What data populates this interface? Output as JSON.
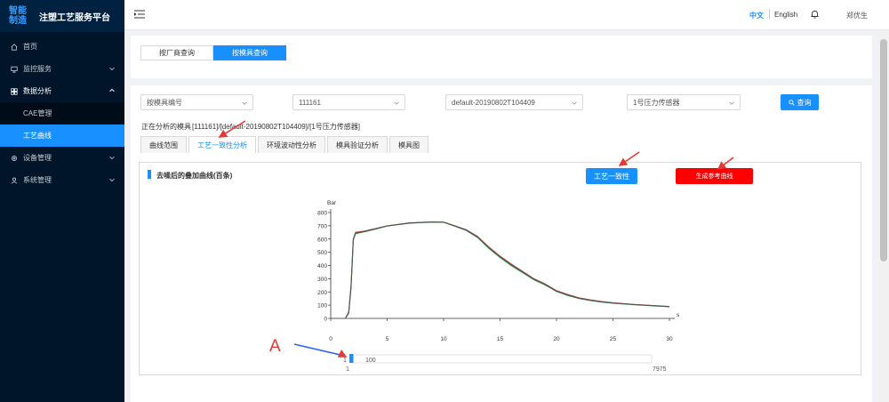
{
  "app": {
    "logo_line1": "智能",
    "logo_line2": "制造",
    "title": "注塑工艺服务平台"
  },
  "sidebar": {
    "items": [
      {
        "label": "首页"
      },
      {
        "label": "监控服务"
      },
      {
        "label": "数据分析"
      },
      {
        "label": "设备管理"
      },
      {
        "label": "系统管理"
      }
    ],
    "submenu": [
      {
        "label": "CAE管理"
      },
      {
        "label": "工艺曲线"
      }
    ]
  },
  "header": {
    "lang_zh": "中文",
    "lang_en": "English",
    "user": "郑优生"
  },
  "query_mode": {
    "by_vendor": "按厂商查询",
    "by_mold": "按模具查询"
  },
  "filters": {
    "mold_type": "按模具编号",
    "mold_no": "111161",
    "config": "default-20190802T104409",
    "sensor": "1号压力传感器",
    "query_label": "查询"
  },
  "analysis": {
    "label": "正在分析的模具",
    "value": "[111161]/[default-20190802T104409]/[1号压力传感器]"
  },
  "tabs": [
    "曲线范围",
    "工艺一致性分析",
    "环境波动性分析",
    "模具验证分析",
    "模具图"
  ],
  "chart_panel": {
    "title": "去噪后的叠加曲线(百条)",
    "consistency_btn": "工艺一致性",
    "gen_ref_btn": "生成参考曲线"
  },
  "annotation": {
    "label": "A"
  },
  "colors": {
    "accent": "#1890ff",
    "danger": "#ff0000",
    "sidebar": "#001529"
  },
  "chart_data": {
    "type": "line",
    "ylabel": "Bar",
    "xlabel": "s",
    "xlim": [
      0,
      30
    ],
    "ylim": [
      0,
      800
    ],
    "xticks": [
      0,
      5,
      10,
      15,
      20,
      25,
      30
    ],
    "yticks": [
      0,
      100,
      200,
      300,
      400,
      500,
      600,
      700,
      800
    ],
    "grid": false,
    "series": [
      {
        "color": "#c0392b",
        "x": [
          0,
          1.3,
          1.6,
          1.8,
          2.0,
          2.2,
          3,
          4,
          5,
          7,
          9,
          10,
          11,
          12,
          13,
          14,
          15,
          16,
          17,
          18,
          19,
          20,
          21,
          22,
          23,
          24,
          25,
          27,
          30
        ],
        "y": [
          0,
          0,
          50,
          250,
          600,
          650,
          660,
          680,
          700,
          722,
          730,
          728,
          700,
          670,
          620,
          540,
          470,
          410,
          355,
          300,
          260,
          210,
          180,
          155,
          140,
          128,
          118,
          105,
          90
        ]
      },
      {
        "color": "#27ae60",
        "x": [
          0,
          1.3,
          1.6,
          1.8,
          2.0,
          2.2,
          3,
          4,
          5,
          7,
          9,
          10,
          11,
          12,
          13,
          14,
          15,
          16,
          17,
          18,
          19,
          20,
          21,
          22,
          23,
          24,
          25,
          27,
          30
        ],
        "y": [
          0,
          0,
          40,
          230,
          590,
          640,
          655,
          675,
          698,
          720,
          728,
          726,
          697,
          665,
          612,
          530,
          460,
          398,
          345,
          292,
          252,
          203,
          173,
          150,
          135,
          123,
          114,
          102,
          88
        ]
      },
      {
        "color": "#555555",
        "x": [
          0,
          1.3,
          1.6,
          1.8,
          2.0,
          2.2,
          3,
          4,
          5,
          7,
          9,
          10,
          11,
          12,
          13,
          14,
          15,
          16,
          17,
          18,
          19,
          20,
          21,
          22,
          23,
          24,
          25,
          27,
          30
        ],
        "y": [
          0,
          0,
          45,
          240,
          595,
          645,
          657,
          678,
          699,
          721,
          729,
          727,
          698,
          668,
          616,
          535,
          465,
          404,
          350,
          296,
          256,
          206,
          176,
          152,
          137,
          125,
          116,
          104,
          89
        ]
      }
    ]
  },
  "slider": {
    "left_value": "1",
    "right_value": "100",
    "min_label": "1",
    "max_label": "7975"
  }
}
